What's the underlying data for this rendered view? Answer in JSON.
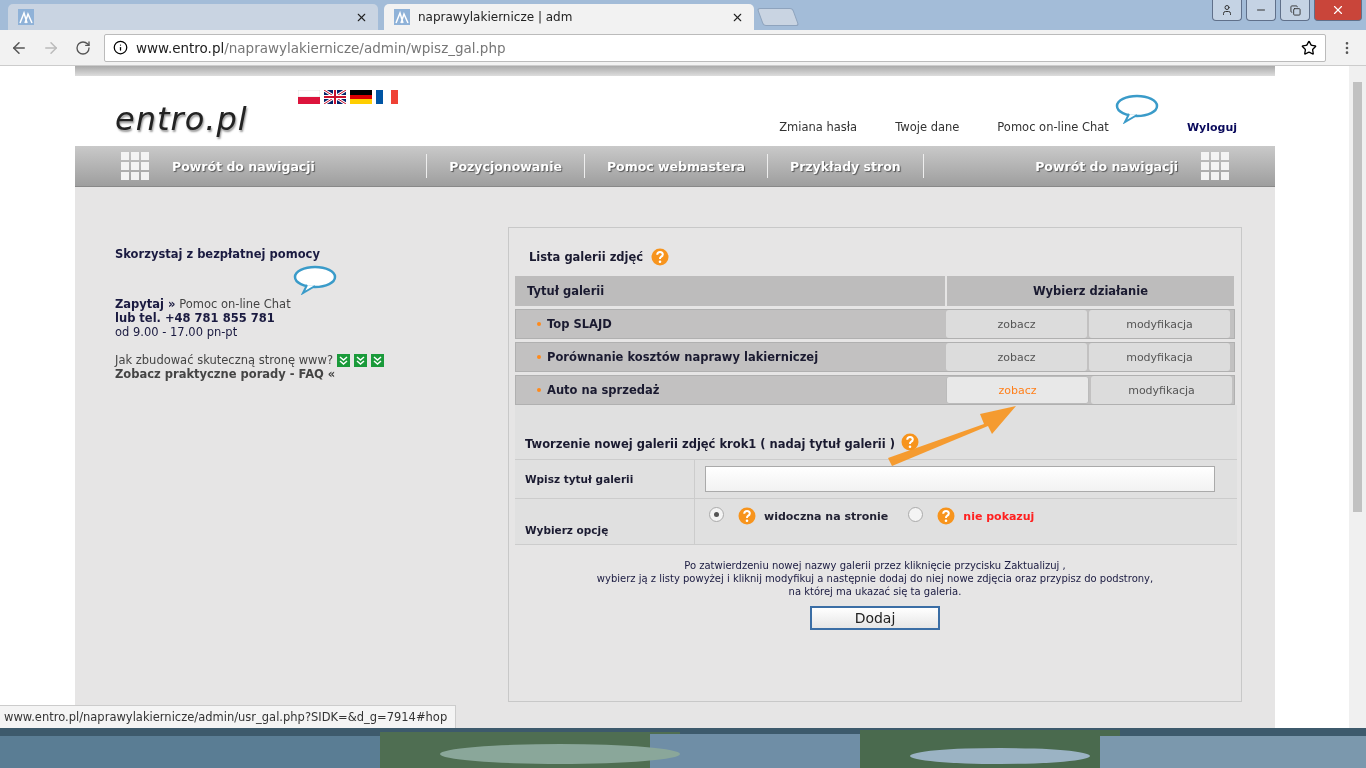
{
  "browser": {
    "tabs": [
      {
        "selected": false
      },
      {
        "label": "naprawylakiernicze | adm",
        "selected": true
      }
    ],
    "url": {
      "host": "www.entro.pl",
      "path": "/naprawylakiernicze/admin/wpisz_gal.php"
    }
  },
  "header": {
    "logo": "entro.pl",
    "flags": [
      {
        "kind": "pl"
      },
      {
        "kind": "gb"
      },
      {
        "kind": "de"
      },
      {
        "kind": "fr"
      }
    ],
    "links": [
      "Zmiana hasła",
      "Twoje dane",
      "Pomoc on-line Chat"
    ],
    "logout": "Wyloguj"
  },
  "nav": [
    "Powrót do nawigacji",
    "Pozycjonowanie",
    "Pomoc webmastera",
    "Przykłady stron",
    "Powrót do nawigacji"
  ],
  "sidebar": {
    "title": "Skorzystaj z bezpłatnej pomocy",
    "ask": "Zapytaj »",
    "chat": "Pomoc on-line Chat",
    "phone": "lub tel. +48 781 855 781",
    "hours": "od 9.00 - 17.00 pn-pt",
    "question": "Jak zbudować skuteczną stronę www?",
    "faq": "Zobacz praktyczne porady - FAQ «"
  },
  "gallery": {
    "title": "Lista galerii zdjęć",
    "columns": [
      "Tytuł galerii",
      "Wybierz działanie"
    ],
    "rows": [
      {
        "title": "Top SLAJD",
        "view": "zobacz",
        "edit": "modyfikacja",
        "highlighted": false
      },
      {
        "title": "Porównanie kosztów naprawy lakierniczej",
        "view": "zobacz",
        "edit": "modyfikacja",
        "highlighted": false
      },
      {
        "title": "Auto na sprzedaż",
        "view": "zobacz",
        "edit": "modyfikacja",
        "highlighted": true
      }
    ]
  },
  "form": {
    "heading": "Tworzenie nowej galerii zdjęć krok1 ( nadaj tytuł galerii )",
    "title_label": "Wpisz tytuł galerii",
    "options_label": "Wybierz opcję",
    "options": [
      {
        "label": "widoczna na stronie",
        "selected": true,
        "color": "#222233"
      },
      {
        "label": "nie pokazuj",
        "selected": false,
        "color": "#ff2020"
      }
    ],
    "note": [
      "Po zatwierdzeniu nowej nazwy galerii przez kliknięcie przycisku Zaktualizuj ,",
      "wybierz ją z listy powyżej i kliknij modyfikuj a następnie dodaj do niej nowe zdjęcia oraz przypisz do podstrony,",
      "na której ma ukazać się ta galeria."
    ],
    "button": "Dodaj"
  },
  "status_url": "www.entro.pl/naprawylakiernicze/admin/usr_gal.php?SIDK=&d_g=7914#hop"
}
